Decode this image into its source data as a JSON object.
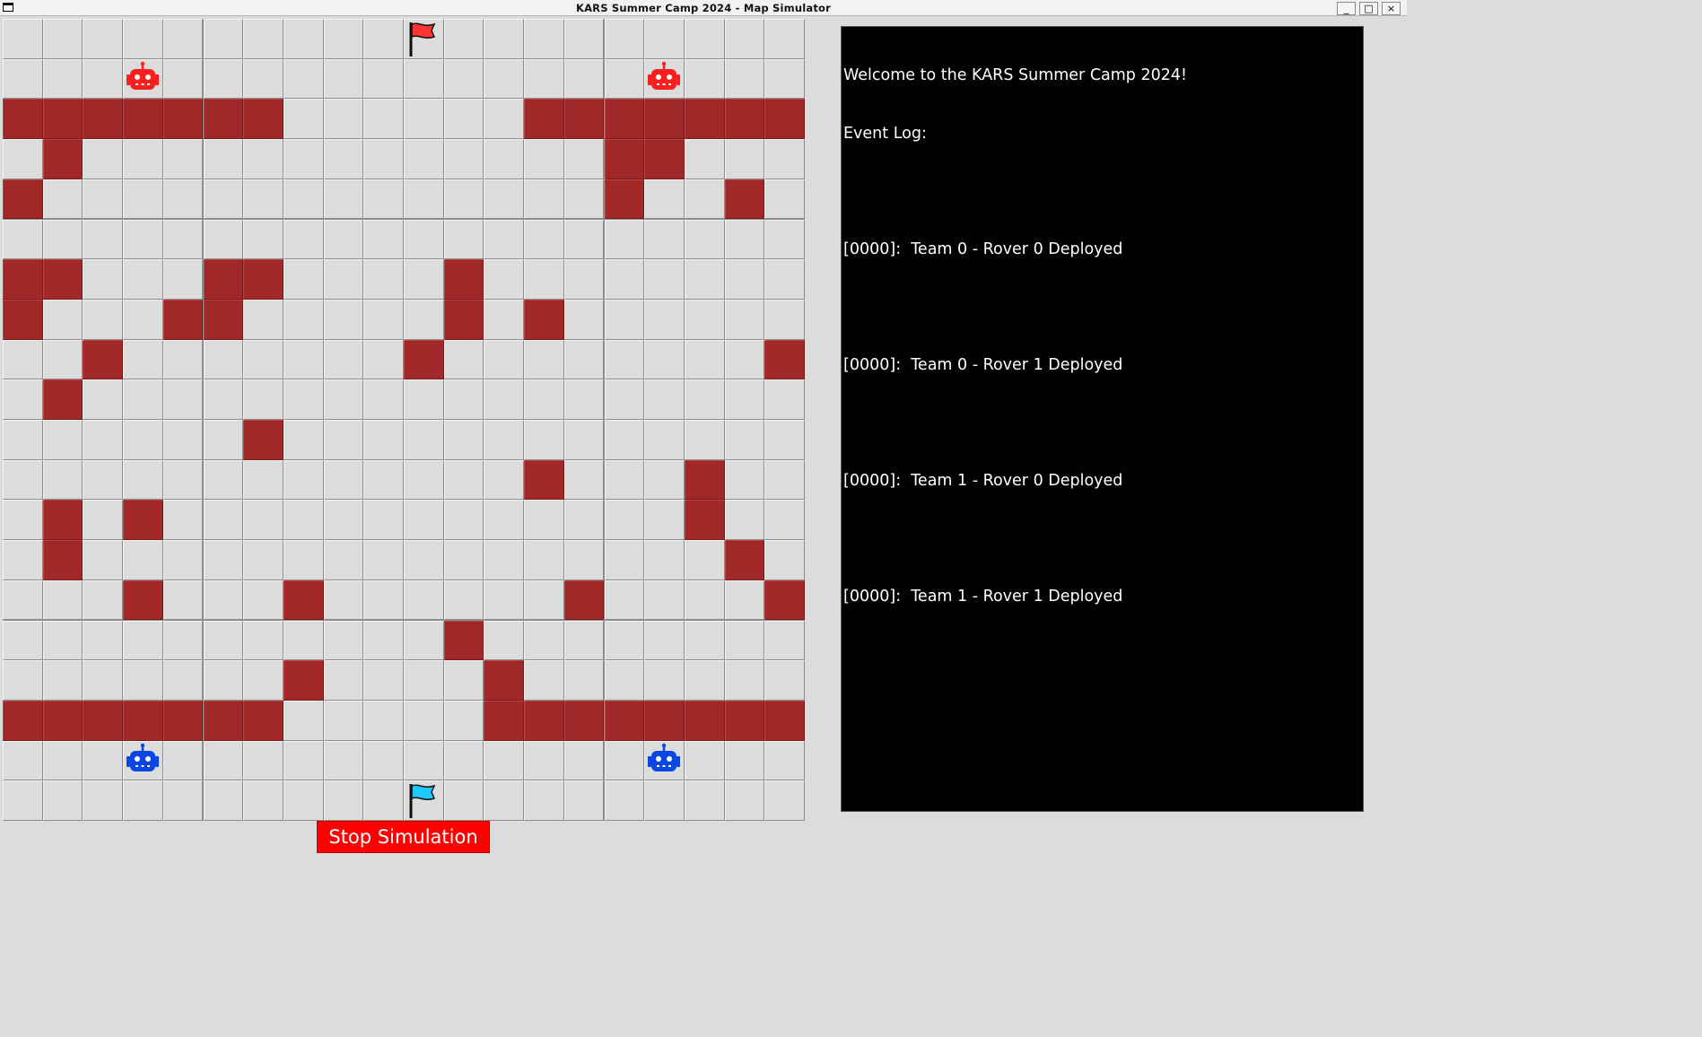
{
  "window": {
    "title": "KARS Summer Camp 2024 - Map Simulator",
    "minimize_label": "_",
    "maximize_label": "□",
    "close_label": "×"
  },
  "colors": {
    "floor": "#dcdcdc",
    "wall": "#a02828",
    "team0": "#ff1e1e",
    "team1": "#0a46e6",
    "flag0": "#ff3232",
    "flag1": "#1ec8ff",
    "stop_button": "#ff0000",
    "log_background": "#000000"
  },
  "map": {
    "rows": 20,
    "cols": 20,
    "walls": [
      [
        2,
        0
      ],
      [
        2,
        1
      ],
      [
        2,
        2
      ],
      [
        2,
        3
      ],
      [
        2,
        4
      ],
      [
        2,
        5
      ],
      [
        2,
        6
      ],
      [
        2,
        13
      ],
      [
        2,
        14
      ],
      [
        2,
        15
      ],
      [
        2,
        16
      ],
      [
        2,
        17
      ],
      [
        2,
        18
      ],
      [
        2,
        19
      ],
      [
        3,
        1
      ],
      [
        3,
        15
      ],
      [
        3,
        16
      ],
      [
        4,
        0
      ],
      [
        4,
        15
      ],
      [
        4,
        18
      ],
      [
        6,
        0
      ],
      [
        6,
        1
      ],
      [
        6,
        5
      ],
      [
        6,
        6
      ],
      [
        6,
        11
      ],
      [
        7,
        0
      ],
      [
        7,
        4
      ],
      [
        7,
        5
      ],
      [
        7,
        11
      ],
      [
        7,
        13
      ],
      [
        8,
        2
      ],
      [
        8,
        10
      ],
      [
        8,
        19
      ],
      [
        9,
        1
      ],
      [
        10,
        6
      ],
      [
        11,
        13
      ],
      [
        11,
        17
      ],
      [
        12,
        1
      ],
      [
        12,
        3
      ],
      [
        12,
        17
      ],
      [
        13,
        1
      ],
      [
        13,
        18
      ],
      [
        14,
        3
      ],
      [
        14,
        7
      ],
      [
        14,
        14
      ],
      [
        14,
        19
      ],
      [
        15,
        11
      ],
      [
        16,
        7
      ],
      [
        16,
        12
      ],
      [
        17,
        0
      ],
      [
        17,
        1
      ],
      [
        17,
        2
      ],
      [
        17,
        3
      ],
      [
        17,
        4
      ],
      [
        17,
        5
      ],
      [
        17,
        6
      ],
      [
        17,
        12
      ],
      [
        17,
        13
      ],
      [
        17,
        14
      ],
      [
        17,
        15
      ],
      [
        17,
        16
      ],
      [
        17,
        17
      ],
      [
        17,
        18
      ],
      [
        17,
        19
      ]
    ],
    "flags": [
      {
        "team": 0,
        "row": 0,
        "col": 10,
        "icon": "flag-icon"
      },
      {
        "team": 1,
        "row": 19,
        "col": 10,
        "icon": "flag-icon"
      }
    ],
    "rovers": [
      {
        "team": 0,
        "rover": 0,
        "row": 1,
        "col": 3,
        "icon": "robot-icon"
      },
      {
        "team": 0,
        "rover": 1,
        "row": 1,
        "col": 16,
        "icon": "robot-icon"
      },
      {
        "team": 1,
        "rover": 0,
        "row": 18,
        "col": 3,
        "icon": "robot-icon"
      },
      {
        "team": 1,
        "rover": 1,
        "row": 18,
        "col": 16,
        "icon": "robot-icon"
      }
    ]
  },
  "log": {
    "welcome": "Welcome to the KARS Summer Camp 2024!",
    "heading": "Event Log:",
    "entries": [
      "[0000]:  Team 0 - Rover 0 Deployed",
      "[0000]:  Team 0 - Rover 1 Deployed",
      "[0000]:  Team 1 - Rover 0 Deployed",
      "[0000]:  Team 1 - Rover 1 Deployed"
    ]
  },
  "controls": {
    "stop_label": "Stop Simulation"
  }
}
